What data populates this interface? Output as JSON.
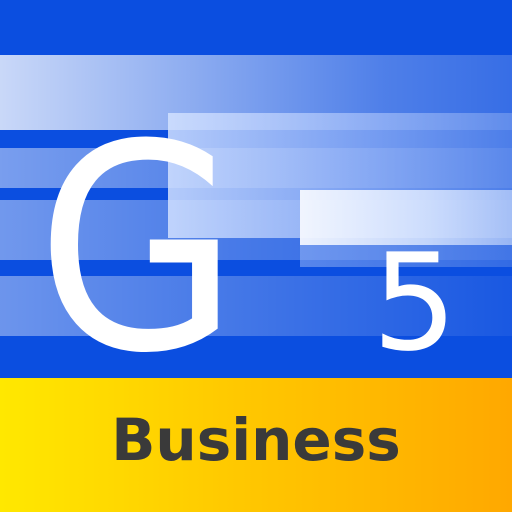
{
  "icon": {
    "letter": "G",
    "number": "5",
    "label": "Business"
  },
  "colors": {
    "blue": "#0b4ee0",
    "yellow": "#ffe800",
    "orange": "#ffa800",
    "label_text": "#3a3a3a",
    "glyph_text": "#ffffff"
  }
}
